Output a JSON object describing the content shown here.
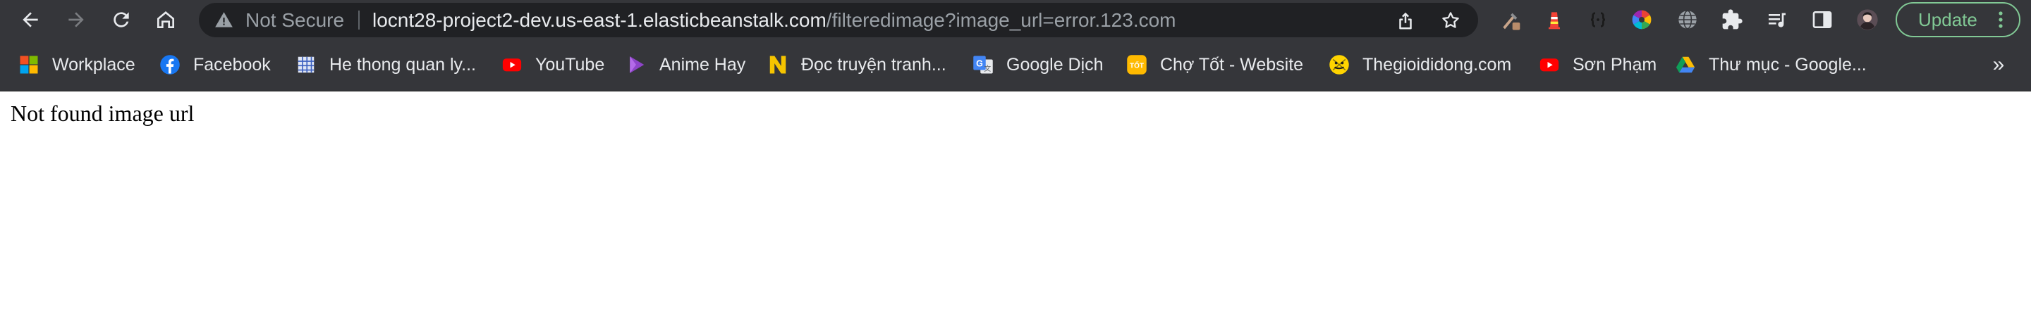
{
  "toolbar": {
    "security_label": "Not Secure",
    "url_host": "locnt28-project2-dev.us-east-1.elasticbeanstalk.com",
    "url_path": "/filteredimage?image_url=error.123.com",
    "update_label": "Update"
  },
  "icons": {
    "back": "arrow-left",
    "forward": "arrow-right",
    "reload": "reload",
    "home": "home",
    "security": "warning-triangle",
    "share": "share",
    "bookmark_star": "star",
    "extensions": [
      "eyedropper",
      "lighthouse",
      "braces",
      "color-wheel",
      "globe",
      "puzzle-piece",
      "media-playlist",
      "side-panel",
      "avatar"
    ],
    "menu": "three-dots-vertical"
  },
  "bookmarks": [
    {
      "label": "Workplace",
      "icon": "workplace-icon"
    },
    {
      "label": "Facebook",
      "icon": "facebook-icon"
    },
    {
      "label": "He thong quan ly...",
      "icon": "grid-icon"
    },
    {
      "label": "YouTube",
      "icon": "youtube-icon"
    },
    {
      "label": "Anime Hay",
      "icon": "play-icon"
    },
    {
      "label": "Đọc truyện tranh...",
      "icon": "n-logo-icon"
    },
    {
      "label": "Google Dịch",
      "icon": "google-translate-icon"
    },
    {
      "label": "Chợ Tốt - Website",
      "icon": "cho-tot-icon"
    },
    {
      "label": "Thegioididong.com",
      "icon": "thegioididong-icon"
    },
    {
      "label": "Sơn Phạm",
      "icon": "youtube-icon"
    },
    {
      "label": "Thư mục - Google...",
      "icon": "google-drive-icon"
    }
  ],
  "bookmarks_overflow": "»",
  "page": {
    "message": "Not found image url"
  },
  "colors": {
    "chrome_bg": "#35363a",
    "omnibox_bg": "#202124",
    "update_accent": "#81c995",
    "page_bg": "#ffffff"
  }
}
